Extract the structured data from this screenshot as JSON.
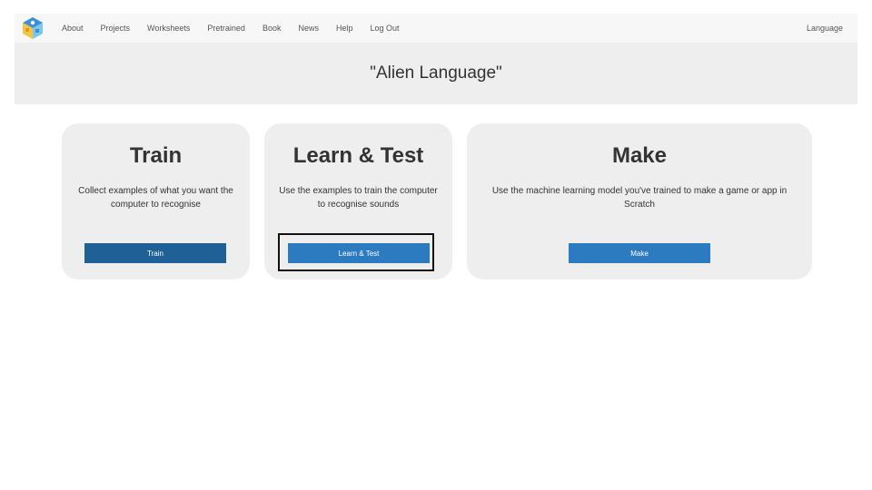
{
  "nav": {
    "logo_icon": "ml4k-cube-logo-icon",
    "links": [
      "About",
      "Projects",
      "Worksheets",
      "Pretrained",
      "Book",
      "News",
      "Help",
      "Log Out"
    ],
    "language_label": "Language"
  },
  "banner": {
    "title": "\"Alien Language\""
  },
  "cards": [
    {
      "title": "Train",
      "description": "Collect examples of what you want the computer to recognise",
      "button_label": "Train"
    },
    {
      "title": "Learn & Test",
      "description": "Use the examples to train the computer to recognise sounds",
      "button_label": "Learn & Test"
    },
    {
      "title": "Make",
      "description": "Use the machine learning model you've trained to make a game or app in Scratch",
      "button_label": "Make"
    }
  ],
  "colors": {
    "button_dark": "#1f6096",
    "button_light": "#2c7bc0",
    "card_bg": "#eeeeee",
    "nav_bg": "#f7f7f7"
  }
}
